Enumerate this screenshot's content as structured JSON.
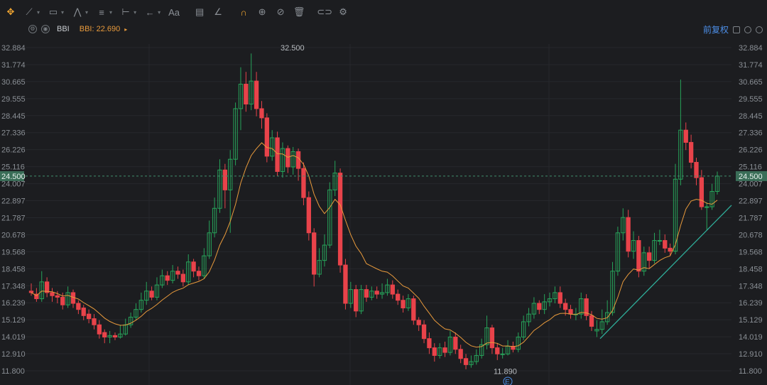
{
  "toolbar": {
    "tools": [
      {
        "name": "crosshair-tool",
        "glyph": "✥",
        "active": true,
        "caret": false
      },
      {
        "name": "trend-line-tool",
        "glyph": "⟋",
        "caret": true
      },
      {
        "name": "rectangle-tool",
        "glyph": "▭",
        "caret": true
      },
      {
        "name": "pattern-tool",
        "glyph": "⋀",
        "caret": true
      },
      {
        "name": "fibonacci-tool",
        "glyph": "≡",
        "caret": true
      },
      {
        "name": "measure-tool",
        "glyph": "⊢",
        "caret": true
      },
      {
        "name": "arrow-tool",
        "glyph": "←",
        "caret": true
      },
      {
        "name": "text-tool",
        "glyph": "Aa",
        "caret": false
      },
      {
        "name": "note-tool",
        "glyph": "▤",
        "caret": false
      },
      {
        "name": "angle-tool",
        "glyph": "∠",
        "caret": false
      },
      {
        "name": "magnet-tool",
        "glyph": "∩",
        "active": true,
        "caret": false
      },
      {
        "name": "lock-tool",
        "glyph": "⊕",
        "caret": false
      },
      {
        "name": "hide-tool",
        "glyph": "⊘",
        "caret": false
      },
      {
        "name": "delete-tool",
        "glyph": "🗑",
        "caret": false
      },
      {
        "name": "link-tool",
        "glyph": "⊂⊃",
        "caret": false
      },
      {
        "name": "settings-tool",
        "glyph": "⚙",
        "caret": false
      }
    ]
  },
  "indicator": {
    "name": "BBI",
    "value_label": "BBI: 22.690"
  },
  "header_right": {
    "adjust_label": "前复权"
  },
  "chart_data": {
    "type": "candlestick",
    "y_ticks": [
      "32.884",
      "31.774",
      "30.665",
      "29.555",
      "28.445",
      "27.336",
      "26.226",
      "25.116",
      "24.007",
      "22.897",
      "21.787",
      "20.678",
      "19.568",
      "18.458",
      "17.348",
      "16.239",
      "15.129",
      "14.019",
      "12.910",
      "11.800"
    ],
    "ylim": [
      11.8,
      32.884
    ],
    "current_price_label": "24.500",
    "current_price": 24.5,
    "high_annotation": "32.500",
    "low_annotation": "11.890",
    "event_marker": "E",
    "up_color": "#27a35a",
    "down_color": "#e8434a",
    "bbi_color": "#e89a3c",
    "trendline_color": "#2fae9a",
    "candles": [
      [
        17.0,
        16.9,
        16.7,
        17.5
      ],
      [
        16.8,
        16.5,
        16.3,
        17.2
      ],
      [
        16.5,
        17.6,
        16.3,
        18.3
      ],
      [
        17.6,
        16.9,
        16.6,
        17.9
      ],
      [
        16.9,
        16.7,
        16.3,
        17.2
      ],
      [
        16.7,
        16.6,
        16.2,
        17.0
      ],
      [
        16.6,
        16.1,
        15.8,
        16.9
      ],
      [
        16.1,
        16.9,
        15.9,
        17.3
      ],
      [
        16.9,
        16.2,
        15.9,
        17.1
      ],
      [
        16.2,
        15.8,
        15.5,
        16.4
      ],
      [
        15.9,
        15.4,
        15.1,
        16.1
      ],
      [
        15.5,
        15.2,
        14.9,
        15.8
      ],
      [
        15.2,
        14.8,
        14.5,
        15.5
      ],
      [
        14.8,
        14.2,
        13.9,
        15.1
      ],
      [
        14.3,
        14.0,
        13.6,
        14.5
      ],
      [
        14.0,
        14.1,
        13.6,
        14.4
      ],
      [
        14.1,
        14.0,
        13.8,
        14.3
      ],
      [
        14.0,
        14.2,
        13.9,
        14.8
      ],
      [
        14.2,
        14.8,
        14.1,
        15.2
      ],
      [
        14.8,
        15.3,
        14.6,
        15.6
      ],
      [
        15.3,
        15.8,
        15.1,
        16.2
      ],
      [
        15.8,
        16.4,
        15.6,
        16.9
      ],
      [
        16.4,
        17.0,
        16.1,
        17.6
      ],
      [
        17.0,
        16.6,
        16.4,
        17.3
      ],
      [
        16.6,
        17.4,
        16.4,
        17.9
      ],
      [
        17.4,
        18.0,
        17.2,
        18.4
      ],
      [
        18.0,
        17.7,
        17.4,
        18.3
      ],
      [
        17.7,
        18.3,
        17.5,
        18.7
      ],
      [
        18.3,
        18.1,
        17.8,
        18.6
      ],
      [
        18.1,
        17.6,
        17.3,
        18.4
      ],
      [
        17.6,
        18.9,
        17.4,
        19.4
      ],
      [
        18.9,
        18.3,
        17.9,
        19.1
      ],
      [
        18.3,
        18.0,
        17.7,
        18.6
      ],
      [
        18.0,
        19.3,
        17.8,
        19.8
      ],
      [
        19.3,
        20.8,
        19.1,
        21.6
      ],
      [
        20.8,
        22.4,
        20.5,
        23.1
      ],
      [
        22.4,
        24.9,
        22.1,
        25.6
      ],
      [
        24.9,
        23.6,
        22.4,
        25.3
      ],
      [
        23.6,
        25.6,
        20.8,
        26.2
      ],
      [
        25.6,
        28.9,
        25.2,
        29.3
      ],
      [
        28.9,
        30.5,
        27.5,
        31.6
      ],
      [
        30.5,
        29.2,
        28.7,
        31.3
      ],
      [
        29.2,
        30.7,
        28.8,
        32.5
      ],
      [
        30.7,
        28.9,
        28.4,
        31.3
      ],
      [
        28.9,
        28.3,
        27.6,
        29.4
      ],
      [
        28.3,
        25.8,
        25.4,
        28.6
      ],
      [
        25.8,
        27.0,
        25.5,
        27.5
      ],
      [
        27.0,
        24.8,
        24.5,
        27.4
      ],
      [
        24.8,
        26.3,
        24.4,
        26.7
      ],
      [
        26.3,
        25.1,
        24.7,
        26.5
      ],
      [
        25.1,
        26.1,
        24.6,
        26.4
      ],
      [
        26.1,
        25.0,
        24.2,
        26.3
      ],
      [
        25.0,
        23.1,
        22.6,
        25.4
      ],
      [
        23.1,
        20.8,
        20.3,
        23.5
      ],
      [
        20.8,
        18.1,
        17.3,
        21.1
      ],
      [
        18.1,
        19.0,
        17.9,
        19.8
      ],
      [
        19.0,
        20.0,
        18.6,
        20.7
      ],
      [
        20.0,
        23.6,
        19.8,
        24.1
      ],
      [
        23.6,
        24.7,
        23.2,
        25.5
      ],
      [
        24.7,
        18.7,
        18.2,
        25.0
      ],
      [
        18.7,
        16.2,
        15.8,
        19.1
      ],
      [
        16.2,
        17.1,
        15.9,
        17.6
      ],
      [
        17.1,
        15.7,
        15.3,
        17.4
      ],
      [
        15.7,
        17.1,
        15.5,
        17.4
      ],
      [
        17.1,
        16.6,
        16.3,
        17.4
      ],
      [
        16.6,
        17.0,
        16.4,
        17.3
      ],
      [
        17.0,
        16.8,
        16.5,
        17.3
      ],
      [
        16.8,
        16.9,
        16.5,
        17.5
      ],
      [
        16.9,
        17.4,
        16.7,
        17.8
      ],
      [
        17.4,
        16.8,
        16.5,
        17.7
      ],
      [
        16.8,
        16.4,
        16.1,
        17.1
      ],
      [
        16.4,
        15.9,
        15.6,
        16.7
      ],
      [
        15.9,
        16.5,
        15.7,
        16.8
      ],
      [
        16.5,
        15.1,
        14.8,
        16.7
      ],
      [
        15.1,
        14.8,
        14.4,
        15.3
      ],
      [
        14.8,
        13.9,
        13.6,
        15.1
      ],
      [
        13.9,
        13.3,
        12.9,
        14.3
      ],
      [
        13.3,
        12.8,
        12.4,
        13.6
      ],
      [
        12.8,
        13.3,
        12.6,
        13.6
      ],
      [
        13.3,
        13.0,
        12.7,
        13.7
      ],
      [
        13.0,
        14.0,
        12.8,
        14.4
      ],
      [
        14.0,
        13.2,
        12.9,
        14.3
      ],
      [
        13.2,
        12.6,
        12.3,
        13.5
      ],
      [
        12.6,
        12.2,
        11.9,
        12.9
      ],
      [
        12.2,
        12.4,
        12.0,
        12.8
      ],
      [
        12.4,
        12.8,
        12.2,
        13.2
      ],
      [
        12.8,
        13.5,
        12.6,
        13.9
      ],
      [
        13.5,
        14.6,
        13.2,
        15.4
      ],
      [
        14.6,
        13.3,
        12.9,
        14.8
      ],
      [
        13.3,
        12.9,
        12.5,
        13.6
      ],
      [
        12.9,
        12.9,
        12.6,
        13.3
      ],
      [
        12.9,
        13.4,
        12.8,
        13.8
      ],
      [
        13.4,
        13.2,
        13.0,
        13.7
      ],
      [
        13.2,
        14.0,
        13.0,
        14.3
      ],
      [
        14.0,
        15.0,
        13.8,
        15.4
      ],
      [
        15.0,
        15.5,
        14.7,
        15.9
      ],
      [
        15.5,
        16.2,
        15.2,
        16.6
      ],
      [
        16.2,
        15.8,
        15.5,
        16.4
      ],
      [
        15.8,
        16.3,
        15.5,
        16.8
      ],
      [
        16.3,
        16.5,
        16.0,
        16.9
      ],
      [
        16.5,
        16.9,
        16.2,
        17.3
      ],
      [
        16.9,
        16.2,
        15.9,
        17.3
      ],
      [
        16.2,
        15.8,
        15.4,
        16.5
      ],
      [
        15.8,
        15.5,
        15.2,
        16.1
      ],
      [
        15.5,
        15.5,
        15.1,
        15.9
      ],
      [
        15.5,
        16.5,
        15.2,
        16.9
      ],
      [
        16.5,
        15.4,
        15.1,
        16.8
      ],
      [
        15.4,
        14.7,
        14.4,
        15.7
      ],
      [
        14.4,
        14.5,
        14.0,
        15.1
      ],
      [
        14.5,
        15.0,
        14.2,
        15.8
      ],
      [
        15.0,
        15.6,
        14.8,
        16.4
      ],
      [
        15.6,
        18.3,
        15.4,
        18.9
      ],
      [
        18.3,
        20.8,
        18.0,
        21.2
      ],
      [
        20.8,
        21.8,
        20.3,
        22.4
      ],
      [
        21.8,
        19.6,
        19.2,
        22.3
      ],
      [
        19.6,
        20.3,
        19.1,
        20.9
      ],
      [
        20.3,
        18.3,
        17.9,
        20.6
      ],
      [
        18.3,
        19.5,
        18.0,
        19.9
      ],
      [
        19.5,
        19.0,
        18.5,
        19.9
      ],
      [
        19.0,
        20.3,
        18.8,
        20.8
      ],
      [
        20.3,
        20.3,
        20.0,
        21.0
      ],
      [
        20.3,
        19.8,
        19.5,
        20.7
      ],
      [
        19.8,
        19.6,
        19.3,
        20.1
      ],
      [
        19.6,
        24.3,
        19.4,
        25.3
      ],
      [
        24.3,
        27.5,
        23.9,
        30.8
      ],
      [
        27.5,
        26.7,
        26.2,
        28.0
      ],
      [
        26.7,
        25.4,
        25.0,
        27.2
      ],
      [
        25.4,
        24.4,
        23.9,
        25.7
      ],
      [
        24.4,
        22.5,
        22.3,
        24.9
      ],
      [
        22.5,
        22.5,
        21.0,
        22.8
      ],
      [
        22.5,
        23.5,
        22.3,
        24.0
      ],
      [
        23.5,
        24.5,
        23.3,
        24.8
      ]
    ]
  }
}
